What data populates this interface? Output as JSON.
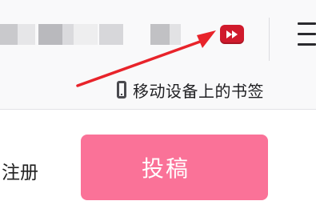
{
  "toolbar": {
    "extension_icon": "video-download-helper-icon",
    "extension_accent": "#d01a2c",
    "menu_icon": "hamburger-menu-icon"
  },
  "bookmarks_bar": {
    "mobile_bookmarks_label": "移动设备上的书签",
    "mobile_icon": "phone-icon"
  },
  "page": {
    "register_label": "注册",
    "submit_label": "投稿",
    "submit_color": "#fa7298"
  },
  "annotation": {
    "arrow_color": "#e8232a"
  }
}
